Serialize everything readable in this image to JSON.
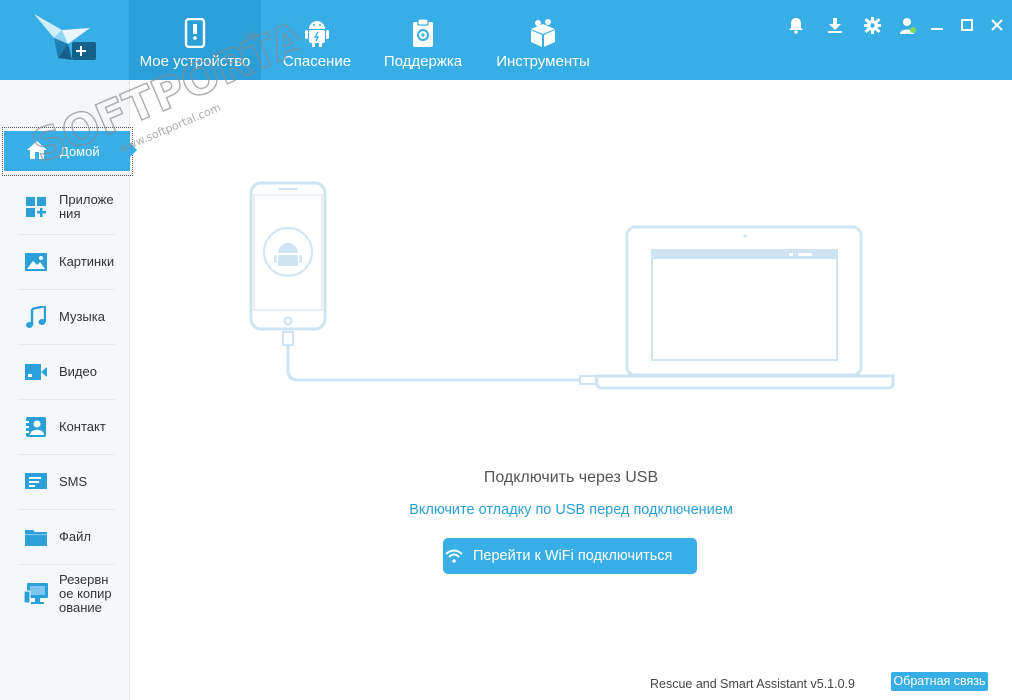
{
  "header": {
    "tabs": [
      {
        "label": "Мое устройство",
        "icon": "phone-icon",
        "active": true
      },
      {
        "label": "Спасение",
        "icon": "android-icon",
        "active": false
      },
      {
        "label": "Поддержка",
        "icon": "clipboard-icon",
        "active": false
      },
      {
        "label": "Инструменты",
        "icon": "toolbox-icon",
        "active": false
      }
    ],
    "window_controls": [
      "bell-icon",
      "download-icon",
      "gear-icon",
      "user-icon",
      "minimize-icon",
      "maximize-icon",
      "close-icon"
    ]
  },
  "sidebar": {
    "items": [
      {
        "label": "Домой",
        "icon": "home-icon",
        "active": true
      },
      {
        "label": "Приложения",
        "icon": "apps-icon"
      },
      {
        "label": "Картинки",
        "icon": "picture-icon"
      },
      {
        "label": "Музыка",
        "icon": "music-icon"
      },
      {
        "label": "Видео",
        "icon": "video-icon"
      },
      {
        "label": "Контакт",
        "icon": "contact-icon"
      },
      {
        "label": "SMS",
        "icon": "sms-icon"
      },
      {
        "label": "Файл",
        "icon": "folder-icon"
      },
      {
        "label": "Резервное копирование",
        "icon": "backup-icon"
      }
    ]
  },
  "main": {
    "title": "Подключить через USB",
    "hint_link": "Включите отладку по USB перед подключением",
    "wifi_button": "Перейти к WiFi подключиться"
  },
  "footer": {
    "version": "Rescue and Smart Assistant v5.1.0.9",
    "feedback": "Обратная связь"
  },
  "watermark": {
    "brand": "SOFTPORTAL",
    "url": "www.softportal.com",
    "tm": "TM"
  },
  "colors": {
    "accent": "#38aee6",
    "active_tab": "#2b9fd8",
    "illustration": "#cfe4f3"
  }
}
